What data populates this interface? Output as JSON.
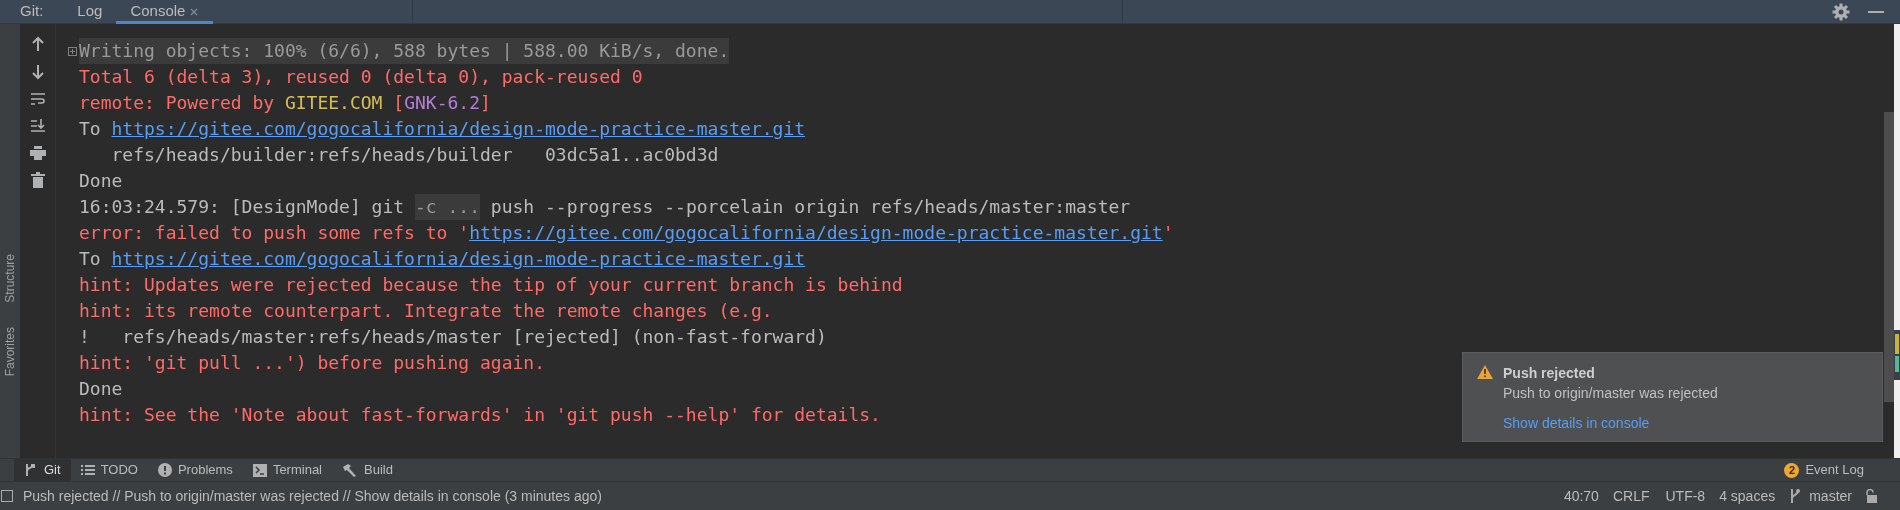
{
  "header": {
    "label": "Git:",
    "tabs": [
      {
        "label": "Log",
        "selected": false,
        "closable": false
      },
      {
        "label": "Console",
        "selected": true,
        "closable": true
      }
    ]
  },
  "side_labels": [
    "Structure",
    "Favorites"
  ],
  "console": {
    "lines": [
      {
        "folded": true,
        "segments": [
          {
            "kind": "dim",
            "text": "Writing objects: 100% (6/6), 588 bytes | 588.00 KiB/s, done."
          }
        ]
      },
      {
        "folded": false,
        "segments": [
          {
            "kind": "error",
            "text": "Total 6 (delta 3), reused 0 (delta 0), pack-reused 0"
          }
        ]
      },
      {
        "folded": false,
        "segments": [
          {
            "kind": "error",
            "text": "remote: Powered by "
          },
          {
            "kind": "yellow",
            "text": "GITEE.COM"
          },
          {
            "kind": "error",
            "text": " ["
          },
          {
            "kind": "purple",
            "text": "GNK-6.2"
          },
          {
            "kind": "error",
            "text": "]"
          }
        ]
      },
      {
        "folded": false,
        "segments": [
          {
            "kind": "plain",
            "text": "To "
          },
          {
            "kind": "link",
            "text": "https://gitee.com/gogocalifornia/design-mode-practice-master.git"
          }
        ]
      },
      {
        "folded": false,
        "segments": [
          {
            "kind": "plain",
            "text": "   refs/heads/builder:refs/heads/builder   03dc5a1..ac0bd3d"
          }
        ]
      },
      {
        "folded": false,
        "segments": [
          {
            "kind": "plain",
            "text": "Done"
          }
        ]
      },
      {
        "folded": false,
        "segments": [
          {
            "kind": "plain",
            "text": "16:03:24.579: [DesignMode] git "
          },
          {
            "kind": "dim",
            "text": "-c ..."
          },
          {
            "kind": "plain",
            "text": " push --progress --porcelain origin refs/heads/master:master"
          }
        ]
      },
      {
        "folded": false,
        "segments": [
          {
            "kind": "error",
            "text": "error: failed to push some refs to '"
          },
          {
            "kind": "link",
            "text": "https://gitee.com/gogocalifornia/design-mode-practice-master.git"
          },
          {
            "kind": "error",
            "text": "'"
          }
        ]
      },
      {
        "folded": false,
        "segments": [
          {
            "kind": "plain",
            "text": "To "
          },
          {
            "kind": "link",
            "text": "https://gitee.com/gogocalifornia/design-mode-practice-master.git"
          }
        ]
      },
      {
        "folded": false,
        "segments": [
          {
            "kind": "error",
            "text": "hint: Updates were rejected because the tip of your current branch is behind"
          }
        ]
      },
      {
        "folded": false,
        "segments": [
          {
            "kind": "error",
            "text": "hint: its remote counterpart. Integrate the remote changes (e.g."
          }
        ]
      },
      {
        "folded": false,
        "segments": [
          {
            "kind": "plain",
            "text": "!   refs/heads/master:refs/heads/master [rejected] (non-fast-forward)"
          }
        ]
      },
      {
        "folded": false,
        "segments": [
          {
            "kind": "error",
            "text": "hint: 'git pull ...') before pushing again."
          }
        ]
      },
      {
        "folded": false,
        "segments": [
          {
            "kind": "plain",
            "text": "Done"
          }
        ]
      },
      {
        "folded": false,
        "segments": [
          {
            "kind": "error",
            "text": "hint: See the 'Note about fast-forwards' in 'git push --help' for details."
          }
        ]
      }
    ]
  },
  "notification": {
    "title": "Push rejected",
    "message": "Push to origin/master was rejected",
    "link": "Show details in console"
  },
  "tool_tabs": [
    {
      "label": "Git",
      "kind": "branch",
      "selected": true
    },
    {
      "label": "TODO",
      "kind": "list",
      "selected": false
    },
    {
      "label": "Problems",
      "kind": "info",
      "selected": false
    },
    {
      "label": "Terminal",
      "kind": "terminal",
      "selected": false
    },
    {
      "label": "Build",
      "kind": "hammer",
      "selected": false
    }
  ],
  "event_log": {
    "count": "2",
    "label": "Event Log"
  },
  "status_bar": {
    "message": "Push rejected // Push to origin/master was rejected // Show details in console (3 minutes ago)",
    "position": "40:70",
    "line_ending": "CRLF",
    "encoding": "UTF-8",
    "indent": "4 spaces",
    "branch": "master"
  }
}
